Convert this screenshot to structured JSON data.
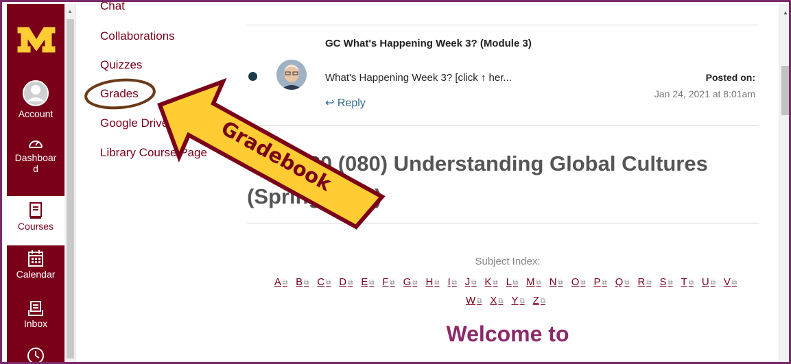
{
  "global_nav": {
    "logo": "minnesota-m-logo",
    "items": [
      {
        "label": "Account",
        "icon": "user-circle-icon"
      },
      {
        "label": "Dashboar\nd",
        "icon": "dashboard-gauge-icon"
      },
      {
        "label": "Courses",
        "icon": "book-icon",
        "active": true
      },
      {
        "label": "Calendar",
        "icon": "calendar-icon"
      },
      {
        "label": "Inbox",
        "icon": "inbox-icon"
      },
      {
        "label": "",
        "icon": "clock-icon"
      }
    ]
  },
  "course_nav": {
    "items": [
      "Chat",
      "Collaborations",
      "Quizzes",
      "Grades",
      "Google Drive",
      "Library Course Page"
    ]
  },
  "discussion": {
    "title": "GC What's Happening Week 3? (Module 3)",
    "message": "What's Happening Week 3? [click ↑ her...",
    "reply_label": "Reply",
    "posted_label": "Posted on:",
    "posted_date": "Jan 24, 2021 at 8:01am"
  },
  "course_title": "GC 1080 (080) Understanding Global Cultures (Spring 2021)",
  "subject_index": {
    "label": "Subject Index:",
    "letters": [
      "A",
      "B",
      "C",
      "D",
      "E",
      "F",
      "G",
      "H",
      "I",
      "J",
      "K",
      "L",
      "M",
      "N",
      "O",
      "P",
      "Q",
      "R",
      "S",
      "T",
      "U",
      "V",
      "W",
      "X",
      "Y",
      "Z"
    ]
  },
  "welcome": "Welcome to",
  "annotation": {
    "arrow_label": "Gradebook"
  },
  "colors": {
    "maroon": "#7a0019",
    "gold": "#ffcc33",
    "link": "#2b6c8f"
  }
}
